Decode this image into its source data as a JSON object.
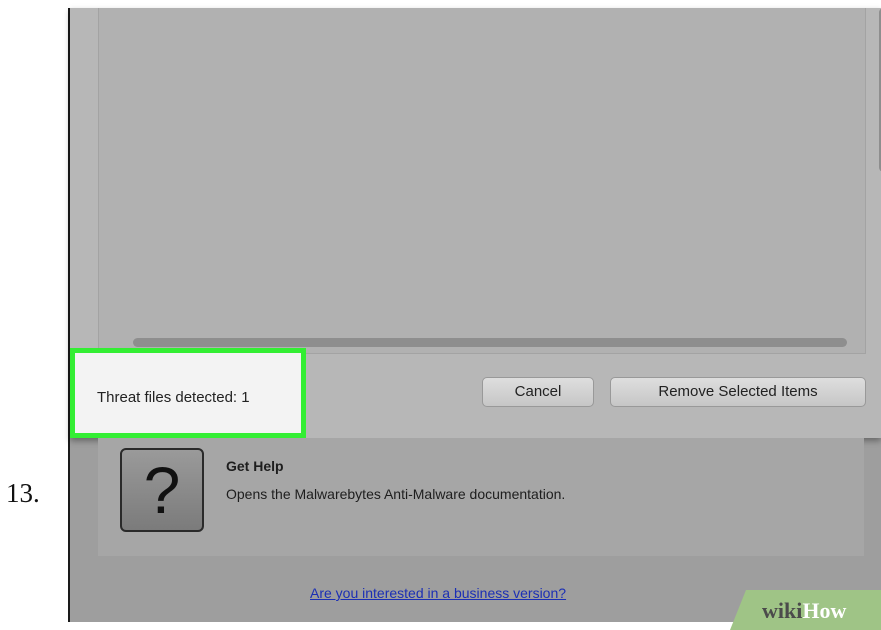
{
  "step": {
    "number": "13."
  },
  "status": {
    "threat_text": "Threat files detected: 1"
  },
  "buttons": {
    "cancel": "Cancel",
    "remove": "Remove Selected Items"
  },
  "help": {
    "icon_glyph": "?",
    "icon": "question-mark-icon",
    "title": "Get Help",
    "description": "Opens the Malwarebytes Anti-Malware documentation."
  },
  "footer": {
    "business_link": "Are you interested in a business version?"
  },
  "watermark": {
    "wiki": "wiki",
    "how": "How"
  },
  "colors": {
    "highlight": "#33ee33",
    "link": "#1b2fb5",
    "watermark_bg": "#9fc486"
  }
}
